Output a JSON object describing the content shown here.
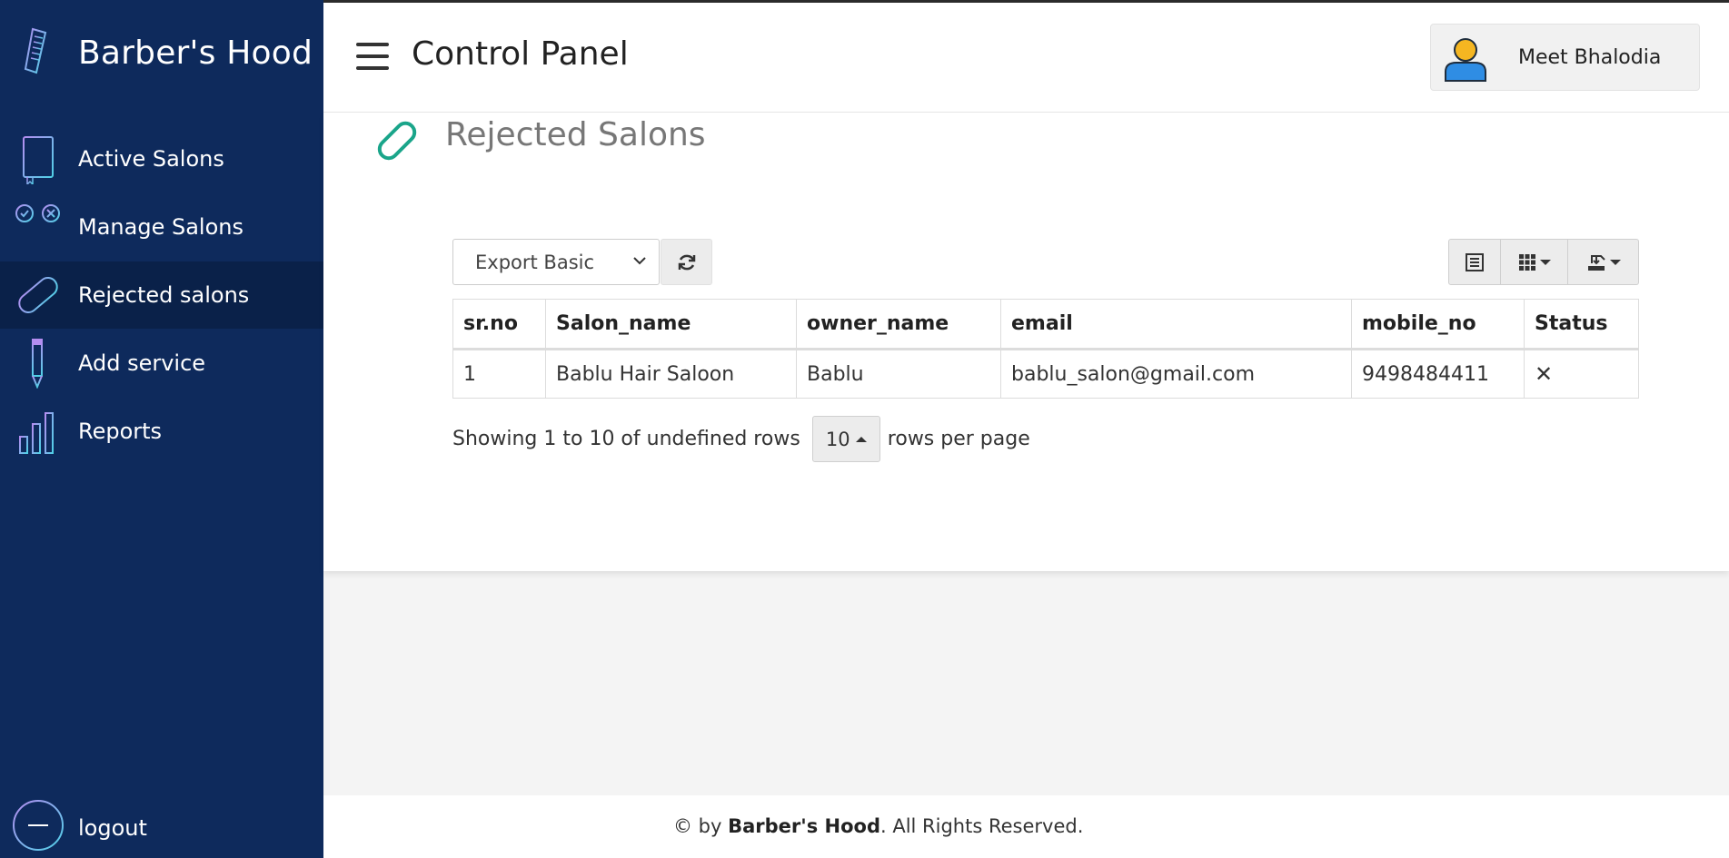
{
  "app": {
    "brand": "Barber's Hood"
  },
  "sidebar": {
    "items": [
      {
        "label": "Active Salons",
        "icon": "book-icon"
      },
      {
        "label": "Manage Salons",
        "icon": "checklist-icon"
      },
      {
        "label": "Rejected salons",
        "icon": "pill-icon",
        "active": true
      },
      {
        "label": "Add service",
        "icon": "pencil-icon"
      },
      {
        "label": "Reports",
        "icon": "bar-chart-icon"
      }
    ],
    "logout_label": "logout"
  },
  "header": {
    "title": "Control Panel",
    "user_name": "Meet Bhalodia"
  },
  "main": {
    "section_title": "Rejected Salons",
    "export_select": {
      "value": "Export Basic",
      "options": [
        "Export Basic"
      ]
    },
    "table": {
      "columns": [
        "sr.no",
        "Salon_name",
        "owner_name",
        "email",
        "mobile_no",
        "Status"
      ],
      "rows": [
        {
          "sr_no": "1",
          "salon_name": "Bablu Hair Saloon",
          "owner_name": "Bablu",
          "email": "bablu_salon@gmail.com",
          "mobile_no": "9498484411",
          "status": "✕"
        }
      ]
    },
    "pagination": {
      "showing_text": "Showing 1 to 10 of undefined rows",
      "page_size": "10",
      "per_page_text": "rows per page"
    }
  },
  "footer": {
    "prefix": "© by ",
    "brand": "Barber's Hood",
    "suffix": ". All Rights Reserved."
  },
  "colors": {
    "sidebar_bg": "#0e2a5c",
    "sidebar_active_bg": "#0a2149",
    "accent_teal": "#1aa58a",
    "icon_purple": "#b48df0",
    "icon_cyan": "#4fd0e6"
  }
}
